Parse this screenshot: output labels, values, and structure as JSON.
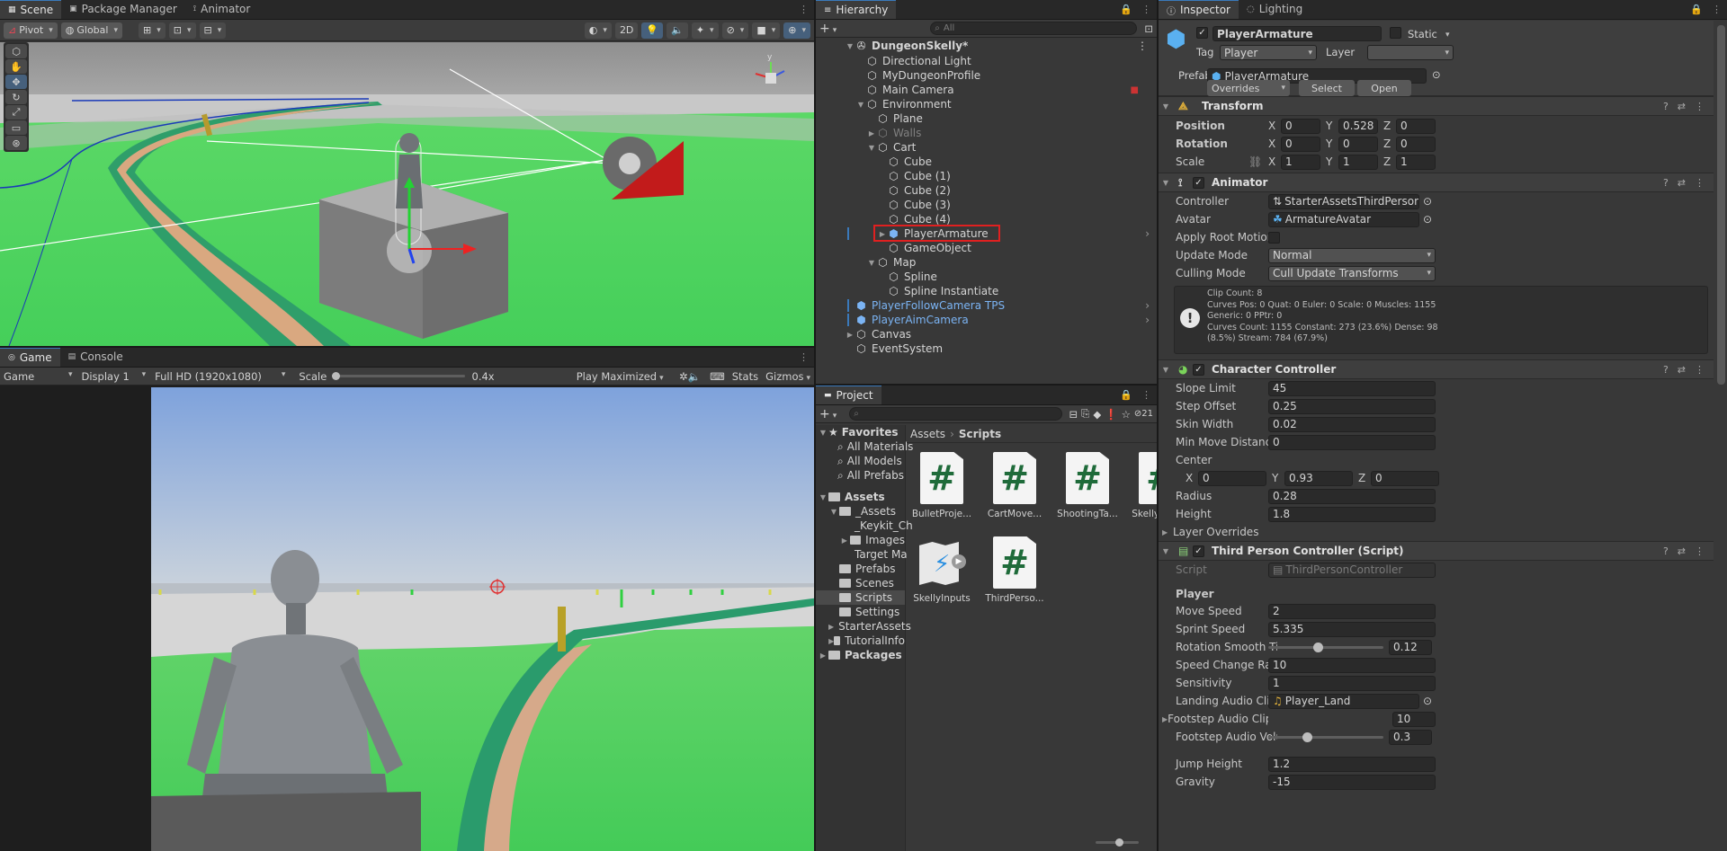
{
  "scene_panel": {
    "tabs": [
      "Scene",
      "Package Manager",
      "Animator"
    ],
    "toolbar": {
      "pivot": "Pivot",
      "global": "Global",
      "mode_2d": "2D"
    }
  },
  "game_panel": {
    "tabs": [
      "Game",
      "Console"
    ],
    "display_mode": "Game",
    "display": "Display 1",
    "resolution": "Full HD (1920x1080)",
    "scale_label": "Scale",
    "scale_value": "0.4x",
    "play_mode": "Play Maximized",
    "stats": "Stats",
    "gizmos": "Gizmos"
  },
  "hierarchy": {
    "tab": "Hierarchy",
    "search_placeholder": "All",
    "items": [
      {
        "label": "DungeonSkelly*"
      },
      {
        "label": "Directional Light"
      },
      {
        "label": "MyDungeonProfile"
      },
      {
        "label": "Main Camera"
      },
      {
        "label": "Environment"
      },
      {
        "label": "Plane"
      },
      {
        "label": "Walls"
      },
      {
        "label": "Cart"
      },
      {
        "label": "Cube"
      },
      {
        "label": "Cube (1)"
      },
      {
        "label": "Cube (2)"
      },
      {
        "label": "Cube (3)"
      },
      {
        "label": "Cube (4)"
      },
      {
        "label": "PlayerArmature"
      },
      {
        "label": "GameObject"
      },
      {
        "label": "Map"
      },
      {
        "label": "Spline"
      },
      {
        "label": "Spline Instantiate"
      },
      {
        "label": "PlayerFollowCamera TPS"
      },
      {
        "label": "PlayerAimCamera"
      },
      {
        "label": "Canvas"
      },
      {
        "label": "EventSystem"
      }
    ]
  },
  "project": {
    "tab": "Project",
    "hidden_count": "21",
    "tree": [
      "Favorites",
      "All Materials",
      "All Models",
      "All Prefabs",
      "Assets",
      "_Assets",
      "_Keykit_Ch",
      "Images",
      "Target Ma",
      "Prefabs",
      "Scenes",
      "Scripts",
      "Settings",
      "StarterAssets",
      "TutorialInfo",
      "Packages"
    ],
    "breadcrumb": [
      "Assets",
      "Scripts"
    ],
    "assets": [
      {
        "name": "BulletProje..."
      },
      {
        "name": "CartMove..."
      },
      {
        "name": "ShootingTa..."
      },
      {
        "name": "SkellyInputs"
      },
      {
        "name": "SkellyInputs"
      },
      {
        "name": "ThirdPerso..."
      }
    ]
  },
  "inspector": {
    "tabs": [
      "Inspector",
      "Lighting"
    ],
    "object_name": "PlayerArmature",
    "static_label": "Static",
    "tag_label": "Tag",
    "tag_value": "Player",
    "layer_label": "Layer",
    "prefab_label": "Prefab",
    "prefab_value": "PlayerArmature",
    "overrides": "Overrides",
    "select": "Select",
    "open": "Open",
    "transform": {
      "title": "Transform",
      "position_label": "Position",
      "position": [
        "0",
        "0.528",
        "0"
      ],
      "rotation_label": "Rotation",
      "rotation": [
        "0",
        "0",
        "0"
      ],
      "scale_label": "Scale",
      "scale": [
        "1",
        "1",
        "1"
      ],
      "axes": [
        "X",
        "Y",
        "Z"
      ]
    },
    "animator": {
      "title": "Animator",
      "controller_label": "Controller",
      "controller": "StarterAssetsThirdPerson",
      "avatar_label": "Avatar",
      "avatar": "ArmatureAvatar",
      "root_motion_label": "Apply Root Motion",
      "update_label": "Update Mode",
      "update": "Normal",
      "culling_label": "Culling Mode",
      "culling": "Cull Update Transforms",
      "info": [
        "Clip Count: 8",
        "Curves Pos: 0 Quat: 0 Euler: 0 Scale: 0 Muscles: 1155",
        "Generic: 0 PPtr: 0",
        "Curves Count: 1155 Constant: 273 (23.6%) Dense: 98",
        "(8.5%) Stream: 784 (67.9%)"
      ]
    },
    "character_controller": {
      "title": "Character Controller",
      "slope_label": "Slope Limit",
      "slope": "45",
      "step_label": "Step Offset",
      "step": "0.25",
      "skin_label": "Skin Width",
      "skin": "0.02",
      "minmove_label": "Min Move Distance",
      "minmove": "0",
      "center_label": "Center",
      "center": [
        "0",
        "0.93",
        "0"
      ],
      "radius_label": "Radius",
      "radius": "0.28",
      "height_label": "Height",
      "height": "1.8",
      "layer_overrides": "Layer Overrides"
    },
    "tpc": {
      "title": "Third Person Controller (Script)",
      "script_label": "Script",
      "script": "ThirdPersonController",
      "section": "Player",
      "move_label": "Move Speed",
      "move": "2",
      "sprint_label": "Sprint Speed",
      "sprint": "5.335",
      "rot_label": "Rotation Smooth Time",
      "rot": "0.12",
      "rot_fraction": 0.39,
      "change_label": "Speed Change Rate",
      "change": "10",
      "sens_label": "Sensitivity",
      "sens": "1",
      "landing_label": "Landing Audio Clip",
      "landing": "Player_Land",
      "footclips_label": "Footstep Audio Clips",
      "footclips": "10",
      "footvol_label": "Footstep Audio Volume",
      "footvol": "0.3",
      "footvol_fraction": 0.3,
      "jump_label": "Jump Height",
      "jump": "1.2",
      "gravity_label": "Gravity",
      "gravity": "-15"
    }
  },
  "colors": {
    "accent": "#3a79bb",
    "selection_outline": "#e02020",
    "prefab_blue": "#7bb4f4",
    "grass": "#4fd65f"
  }
}
